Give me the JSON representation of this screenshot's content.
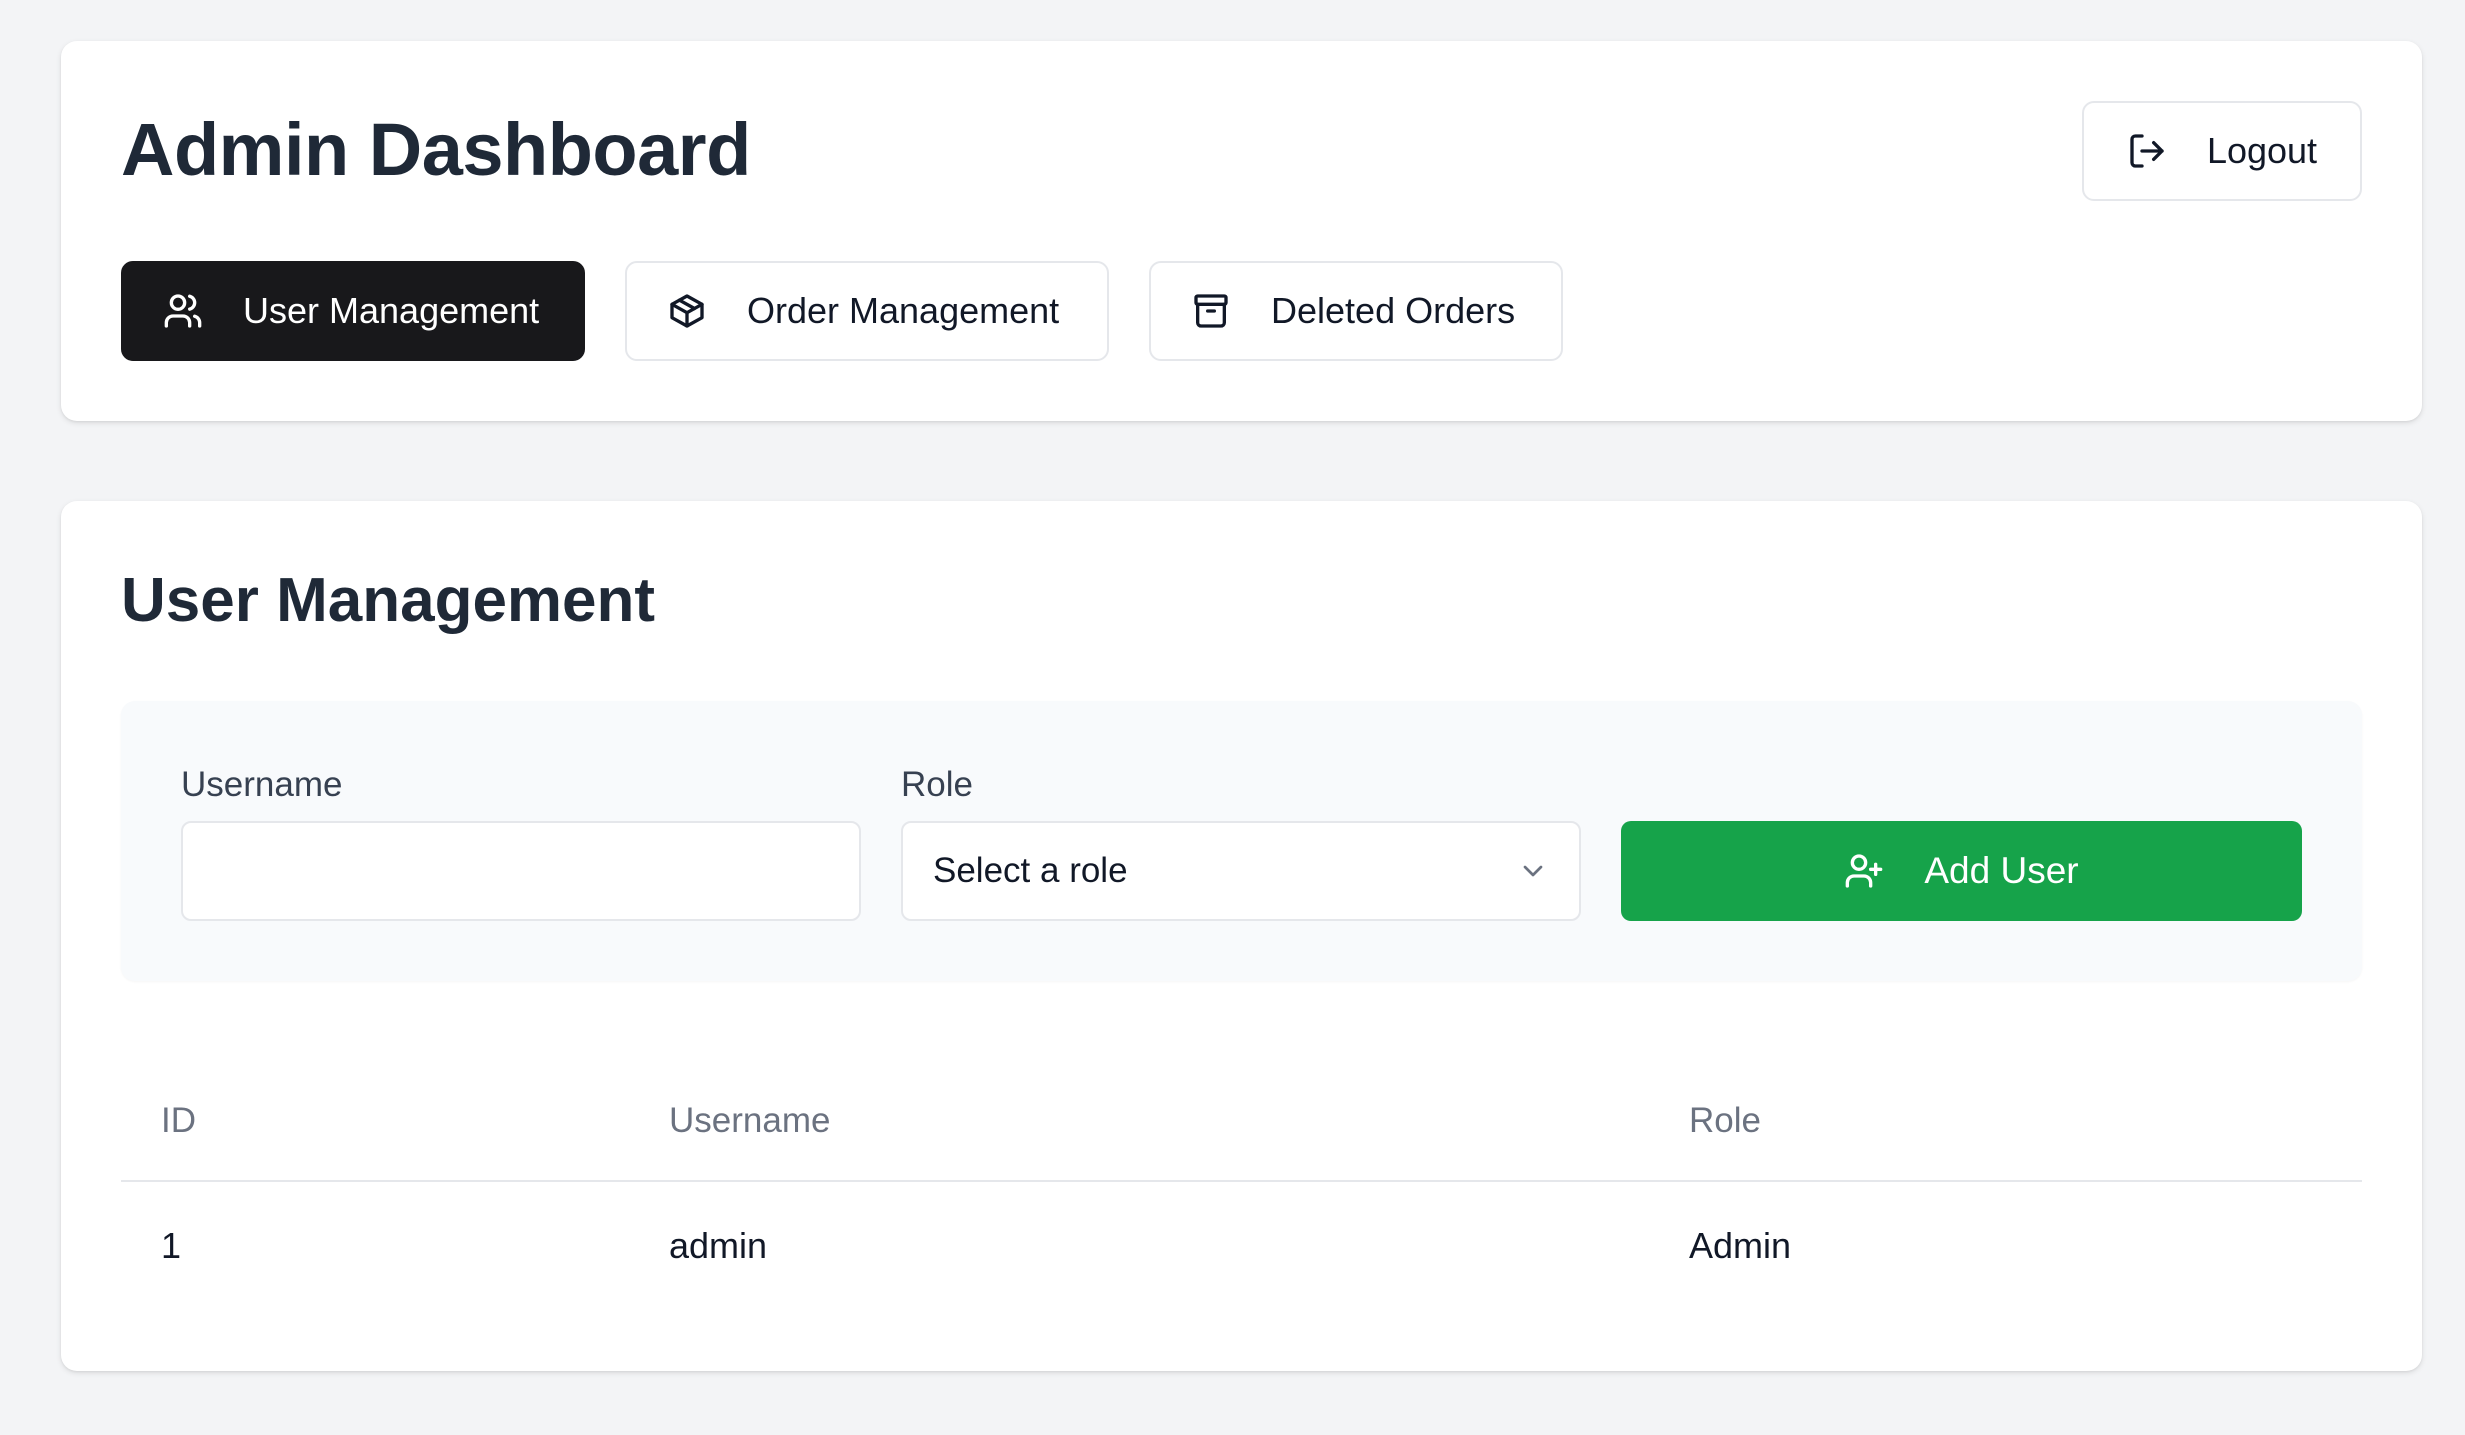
{
  "header": {
    "title": "Admin Dashboard",
    "logout_label": "Logout",
    "logout_icon": "logout-icon"
  },
  "tabs": [
    {
      "label": "User Management",
      "icon": "users-icon",
      "active": true
    },
    {
      "label": "Order Management",
      "icon": "package-icon",
      "active": false
    },
    {
      "label": "Deleted Orders",
      "icon": "archive-icon",
      "active": false
    }
  ],
  "user_management": {
    "title": "User Management",
    "form": {
      "username_label": "Username",
      "username_value": "",
      "username_placeholder": "",
      "role_label": "Role",
      "role_value": "Select a role",
      "add_button_label": "Add User",
      "add_button_icon": "user-plus-icon"
    },
    "table": {
      "columns": [
        "ID",
        "Username",
        "Role"
      ],
      "rows": [
        [
          "1",
          "admin",
          "Admin"
        ]
      ]
    }
  },
  "colors": {
    "background": "#f3f4f6",
    "active_tab": "#18181b",
    "add_button": "#16a34a",
    "title_text": "#1f2937"
  }
}
